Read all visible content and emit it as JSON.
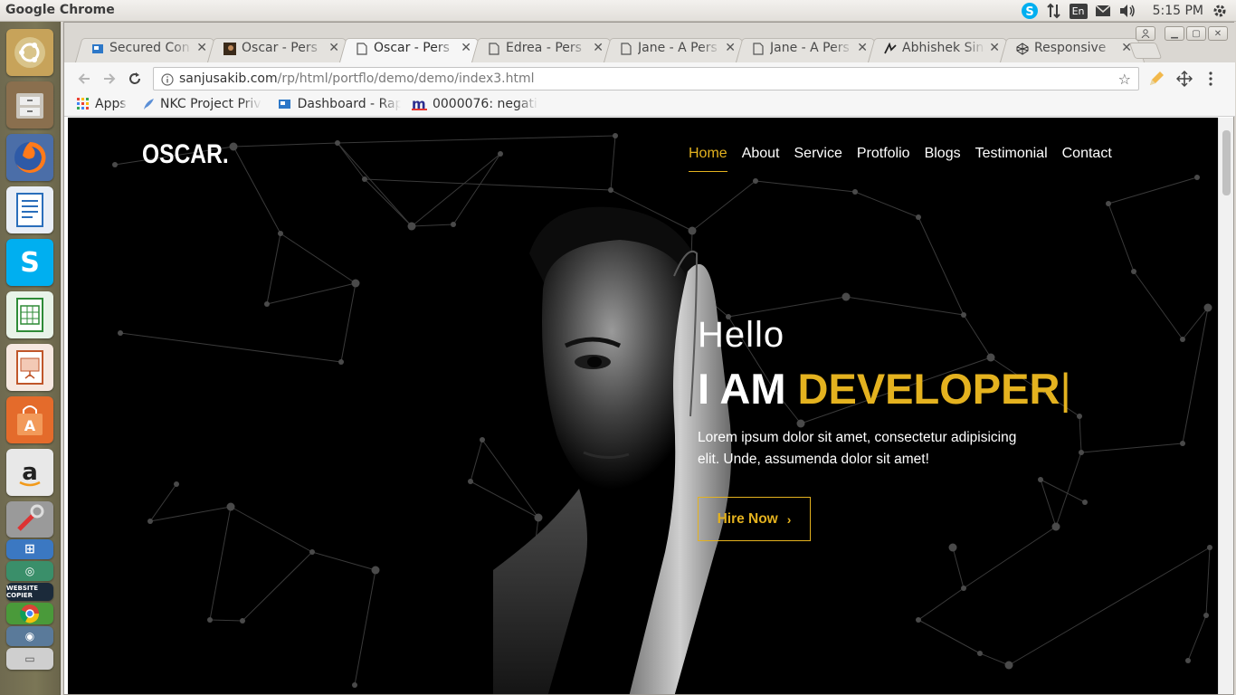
{
  "system": {
    "app_title": "Google Chrome",
    "keyboard_layout": "En",
    "clock": "5:15 PM"
  },
  "launcher": {
    "apps": [
      {
        "name": "ubuntu-dash",
        "color": "#c7a35a"
      },
      {
        "name": "files",
        "color": "#8a6f4e"
      },
      {
        "name": "firefox",
        "color": "#e66000"
      },
      {
        "name": "libreoffice-writer",
        "color": "#2a6ebb"
      },
      {
        "name": "skype",
        "color": "#00aff0"
      },
      {
        "name": "libreoffice-calc",
        "color": "#2e8b37"
      },
      {
        "name": "libreoffice-impress",
        "color": "#c0562a"
      },
      {
        "name": "ubuntu-software",
        "color": "#e46b2b"
      },
      {
        "name": "amazon",
        "color": "#dddddd"
      },
      {
        "name": "system-settings",
        "color": "#9a9a9a"
      },
      {
        "name": "website-copier",
        "color": "#3b78c2",
        "label": "WEBSITE COPIER"
      },
      {
        "name": "chrome",
        "color": "#4a9a3a"
      },
      {
        "name": "disk-tool",
        "color": "#5a7a9a"
      },
      {
        "name": "scanner",
        "color": "#cfcfcf"
      }
    ]
  },
  "browser": {
    "tabs": [
      {
        "title": "Secured Con",
        "active": false
      },
      {
        "title": "Oscar - Pers",
        "active": false
      },
      {
        "title": "Oscar - Pers",
        "active": true
      },
      {
        "title": "Edrea - Pers",
        "active": false
      },
      {
        "title": "Jane - A Pers",
        "active": false
      },
      {
        "title": "Jane - A Pers",
        "active": false
      },
      {
        "title": "Abhishek Sin",
        "active": false
      },
      {
        "title": "Responsive",
        "active": false
      }
    ],
    "address": {
      "host": "sanjusakib.com",
      "path": "/rp/html/portflo/demo/demo/index3.html"
    },
    "bookmarks": [
      {
        "label": "Apps"
      },
      {
        "label": "NKC Project Priv"
      },
      {
        "label": "Dashboard - Rap"
      },
      {
        "label": "0000076: negativ"
      }
    ]
  },
  "site": {
    "logo": "OSCAR.",
    "nav": [
      {
        "label": "Home",
        "active": true
      },
      {
        "label": "About",
        "active": false
      },
      {
        "label": "Service",
        "active": false
      },
      {
        "label": "Protfolio",
        "active": false
      },
      {
        "label": "Blogs",
        "active": false
      },
      {
        "label": "Testimonial",
        "active": false
      },
      {
        "label": "Contact",
        "active": false
      }
    ],
    "hero": {
      "greeting": "Hello",
      "headline_prefix": "I AM",
      "headline_accent": "DEVELOPER",
      "cursor": "|",
      "intro": "Lorem ipsum dolor sit amet, consectetur adipisicing elit. Unde, assumenda dolor sit amet!",
      "cta_label": "Hire Now",
      "accent_color": "#e4b21f"
    }
  }
}
